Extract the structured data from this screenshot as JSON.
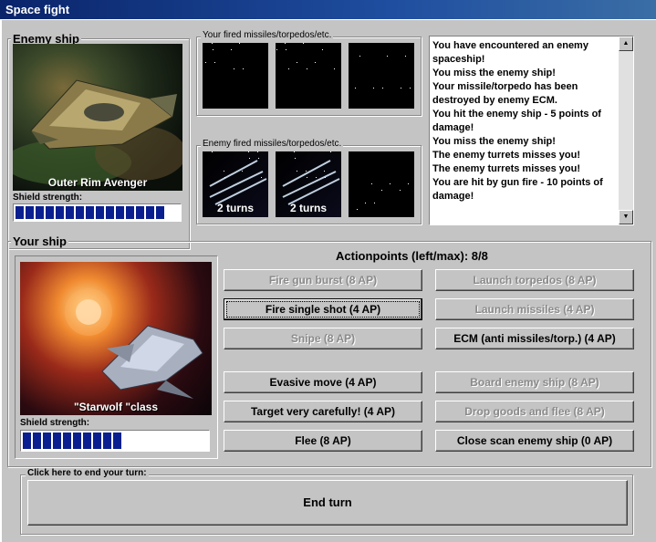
{
  "window": {
    "title": "Space fight"
  },
  "enemy": {
    "group_label": "Enemy ship",
    "ship_name": "Outer Rim Avenger",
    "shield_label": "Shield strength:",
    "shield_segments": 15
  },
  "fired": {
    "yours_label": "Your fired missiles/torpedos/etc.",
    "enemy_label": "Enemy fired missiles/torpedos/etc.",
    "enemy_slots": [
      {
        "turns": "2 turns"
      },
      {
        "turns": "2 turns"
      },
      {
        "turns": ""
      }
    ]
  },
  "log": {
    "text": "You have encountered an enemy spaceship!\nYou miss the enemy ship!\nYour missile/torpedo has been destroyed by enemy ECM.\nYou hit the enemy ship - 5 points of damage!\nYou miss the enemy ship!\nThe enemy turrets misses you!\nThe enemy turrets misses you!\nYou are hit by gun fire - 10 points of damage!"
  },
  "your": {
    "group_label": "Your ship",
    "ship_name": "\"Starwolf \"class",
    "shield_label": "Shield strength:",
    "shield_segments": 10
  },
  "actions": {
    "ap_label": "Actionpoints (left/max): 8/8",
    "fire_gun_burst": "Fire gun burst (8 AP)",
    "fire_single_shot": "Fire single shot (4 AP)",
    "snipe": "Snipe (8 AP)",
    "evasive_move": "Evasive move (4 AP)",
    "target_carefully": "Target very carefully! (4 AP)",
    "flee": "Flee (8 AP)",
    "launch_torpedos": "Launch torpedos (8 AP)",
    "launch_missiles": "Launch missiles (4 AP)",
    "ecm": "ECM (anti missiles/torp.) (4 AP)",
    "board_enemy": "Board enemy ship (8 AP)",
    "drop_goods": "Drop goods and flee (8 AP)",
    "close_scan": "Close scan enemy ship (0 AP)"
  },
  "end_turn": {
    "group_label": "Click here to end your turn:",
    "button": "End turn"
  },
  "colors": {
    "shield": "#0a1f8f",
    "titlebar": "#0a246a",
    "panel": "#c4c4c4"
  }
}
